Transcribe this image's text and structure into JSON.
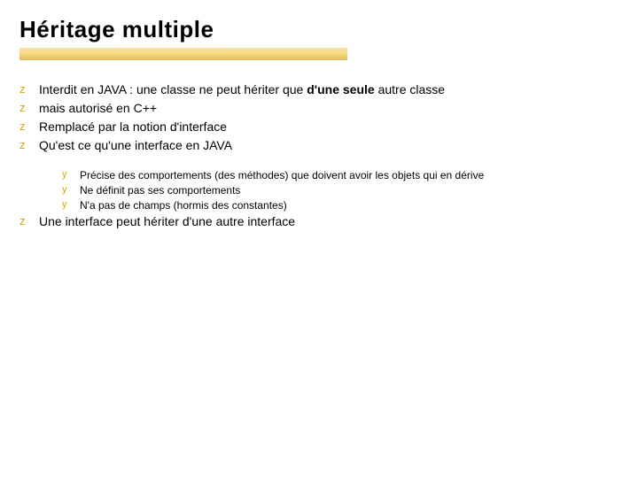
{
  "title": "Héritage multiple",
  "bullets": [
    {
      "pre": "Interdit en JAVA : une classe ne peut hériter que ",
      "bold": "d'une seule",
      "post": " autre classe"
    },
    {
      "pre": "mais autorisé en C++",
      "bold": "",
      "post": ""
    },
    {
      "pre": "Remplacé par la notion d'interface",
      "bold": "",
      "post": ""
    },
    {
      "pre": "Qu'est ce qu'une interface en JAVA",
      "bold": "",
      "post": ""
    }
  ],
  "sub_bullets": [
    "Précise des comportements (des méthodes) que doivent avoir les objets qui en dérive",
    "Ne définit pas ses comportements",
    "N'a pas de champs (hormis des constantes)"
  ],
  "after": [
    "Une interface peut hériter d'une autre interface"
  ],
  "glyphs": {
    "z": "z",
    "y": "y"
  }
}
